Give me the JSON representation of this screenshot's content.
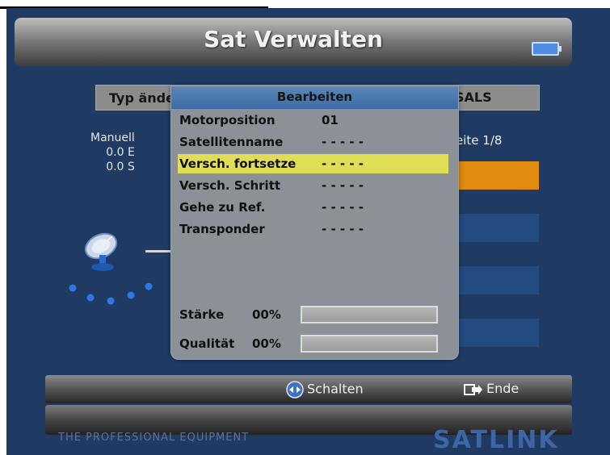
{
  "header": {
    "title": "Sat Verwalten",
    "battery_icon": "battery-icon"
  },
  "background": {
    "row_left_label": "Typ ände",
    "row_right_label": "SALS",
    "side_lines": [
      "Manuell",
      "0.0 E",
      "0.0 S"
    ],
    "page_label": "eite 1/8"
  },
  "dialog": {
    "title": "Bearbeiten",
    "rows": [
      {
        "label": "Motorposition",
        "value": "01"
      },
      {
        "label": "Satellitenname",
        "value": "- - - - -"
      },
      {
        "label": "Versch. fortsetze",
        "value": "- - - - -"
      },
      {
        "label": "Versch. Schritt",
        "value": "- - - - -"
      },
      {
        "label": "Gehe zu Ref.",
        "value": "- - - - -"
      },
      {
        "label": "Transponder",
        "value": "- - - - -"
      }
    ],
    "selected_row": 2,
    "meters": [
      {
        "label": "Stärke",
        "percent_text": "00%",
        "level": 0
      },
      {
        "label": "Qualität",
        "percent_text": "00%",
        "level": 0
      }
    ]
  },
  "footer": {
    "switch_label": "Schalten",
    "switch_icon": "left-right-arrows-icon",
    "exit_label": "Ende",
    "exit_icon": "exit-icon"
  },
  "brand": {
    "left": "THE PROFESSIONAL EQUIPMENT",
    "right": "SATLINK"
  },
  "colors": {
    "highlight": "#e0de55",
    "accent": "#e08a10",
    "panel_bg": "#1f3a63"
  }
}
